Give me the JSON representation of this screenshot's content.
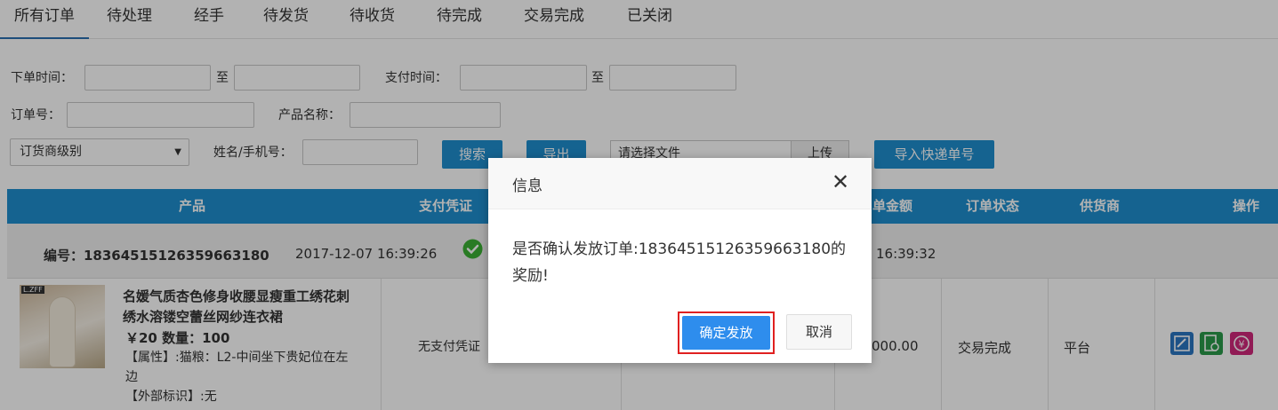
{
  "tabs": [
    "所有订单",
    "待处理",
    "经手",
    "待发货",
    "待收货",
    "待完成",
    "交易完成",
    "已关闭"
  ],
  "filters": {
    "order_time_label": "下单时间：",
    "to_label_1": "至",
    "pay_time_label": "支付时间：",
    "to_label_2": "至",
    "order_no_label": "订单号：",
    "product_name_label": "产品名称：",
    "dealer_level_select": "订货商级别",
    "name_phone_label": "姓名/手机号：",
    "search_button": "搜索",
    "export_button": "导出",
    "file_placeholder": "请选择文件",
    "upload_button": "上传",
    "import_button": "导入快递单号"
  },
  "table": {
    "headers": {
      "product": "产品",
      "payment_proof": "支付凭证",
      "order_amount": "单金额",
      "order_status": "订单状态",
      "supplier": "供货商",
      "action": "操作"
    },
    "order": {
      "number_label": "编号：1836451512635966318​0",
      "created_time": "2017-12-07 16:39:26",
      "paid_time_partial": "16:39:32",
      "product_title_line1": "名媛气质杏色修身收腰显瘦重工绣花刺",
      "product_title_line2": "绣水溶镂空蕾丝网纱连衣裙",
      "price_qty": "￥20 数量：100",
      "attr_line1": "【属性】:猫粮：L2-中间坐下贵妃位在左",
      "attr_line2": "边",
      "external_tag": "【外部标识】:无",
      "thumb_logo": "L.ZFF",
      "payment_proof": "无支付凭证",
      "amount_partial": "000.00",
      "status": "交易完成",
      "supplier": "平台"
    }
  },
  "dialog": {
    "title": "信息",
    "message": "是否确认发放订单:18364515126359663180的奖励!",
    "confirm_button": "确定发放",
    "cancel_button": "取消",
    "close_icon": "close-icon"
  },
  "colors": {
    "primary": "#1f8fcf",
    "confirm": "#2e8ded",
    "highlight": "#e02020",
    "success": "#3cb034"
  }
}
